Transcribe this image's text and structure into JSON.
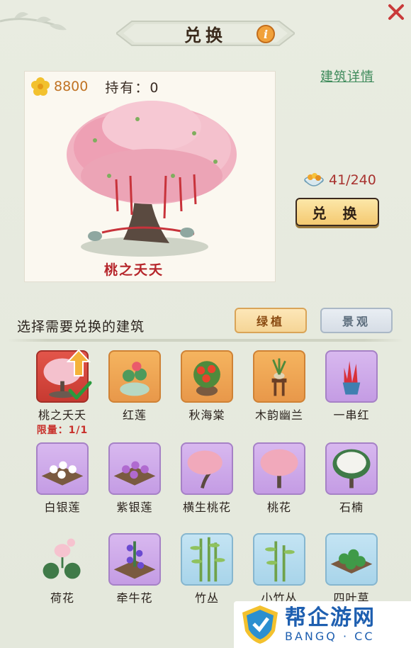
{
  "title": "兑换",
  "close_icon": "close-icon",
  "info_icon": "i",
  "currency": {
    "icon": "flower-coin-icon",
    "value": "8800"
  },
  "hold": "持有：0",
  "detail_link": "建筑详情",
  "preview": {
    "name": "桃之夭夭"
  },
  "cost": {
    "icon": "food-bowl-icon",
    "value": "41/240"
  },
  "exchange_button": "兑 换",
  "section_label": "选择需要兑换的建筑",
  "tabs": [
    {
      "label": "绿植",
      "active": true
    },
    {
      "label": "景观",
      "active": false
    }
  ],
  "items": [
    {
      "name": "桃之夭夭",
      "limit": "限量：1/1",
      "bg": "red",
      "selected": true,
      "upgradable": true
    },
    {
      "name": "红莲",
      "bg": "orange"
    },
    {
      "name": "秋海棠",
      "bg": "orange"
    },
    {
      "name": "木韵幽兰",
      "bg": "orange"
    },
    {
      "name": "一串红",
      "bg": "purple"
    },
    {
      "name": "白银莲",
      "bg": "purple"
    },
    {
      "name": "紫银莲",
      "bg": "purple"
    },
    {
      "name": "横生桃花",
      "bg": "purple"
    },
    {
      "name": "桃花",
      "bg": "purple"
    },
    {
      "name": "石楠",
      "bg": "purple"
    },
    {
      "name": "荷花",
      "bg": "purple"
    },
    {
      "name": "牵牛花",
      "bg": "purple"
    },
    {
      "name": "竹丛",
      "bg": "blue"
    },
    {
      "name": "小竹丛",
      "bg": "blue"
    },
    {
      "name": "四叶草",
      "bg": "blue"
    }
  ],
  "watermark": {
    "title": "帮企游网",
    "subtitle": "BANGQ · CC"
  }
}
